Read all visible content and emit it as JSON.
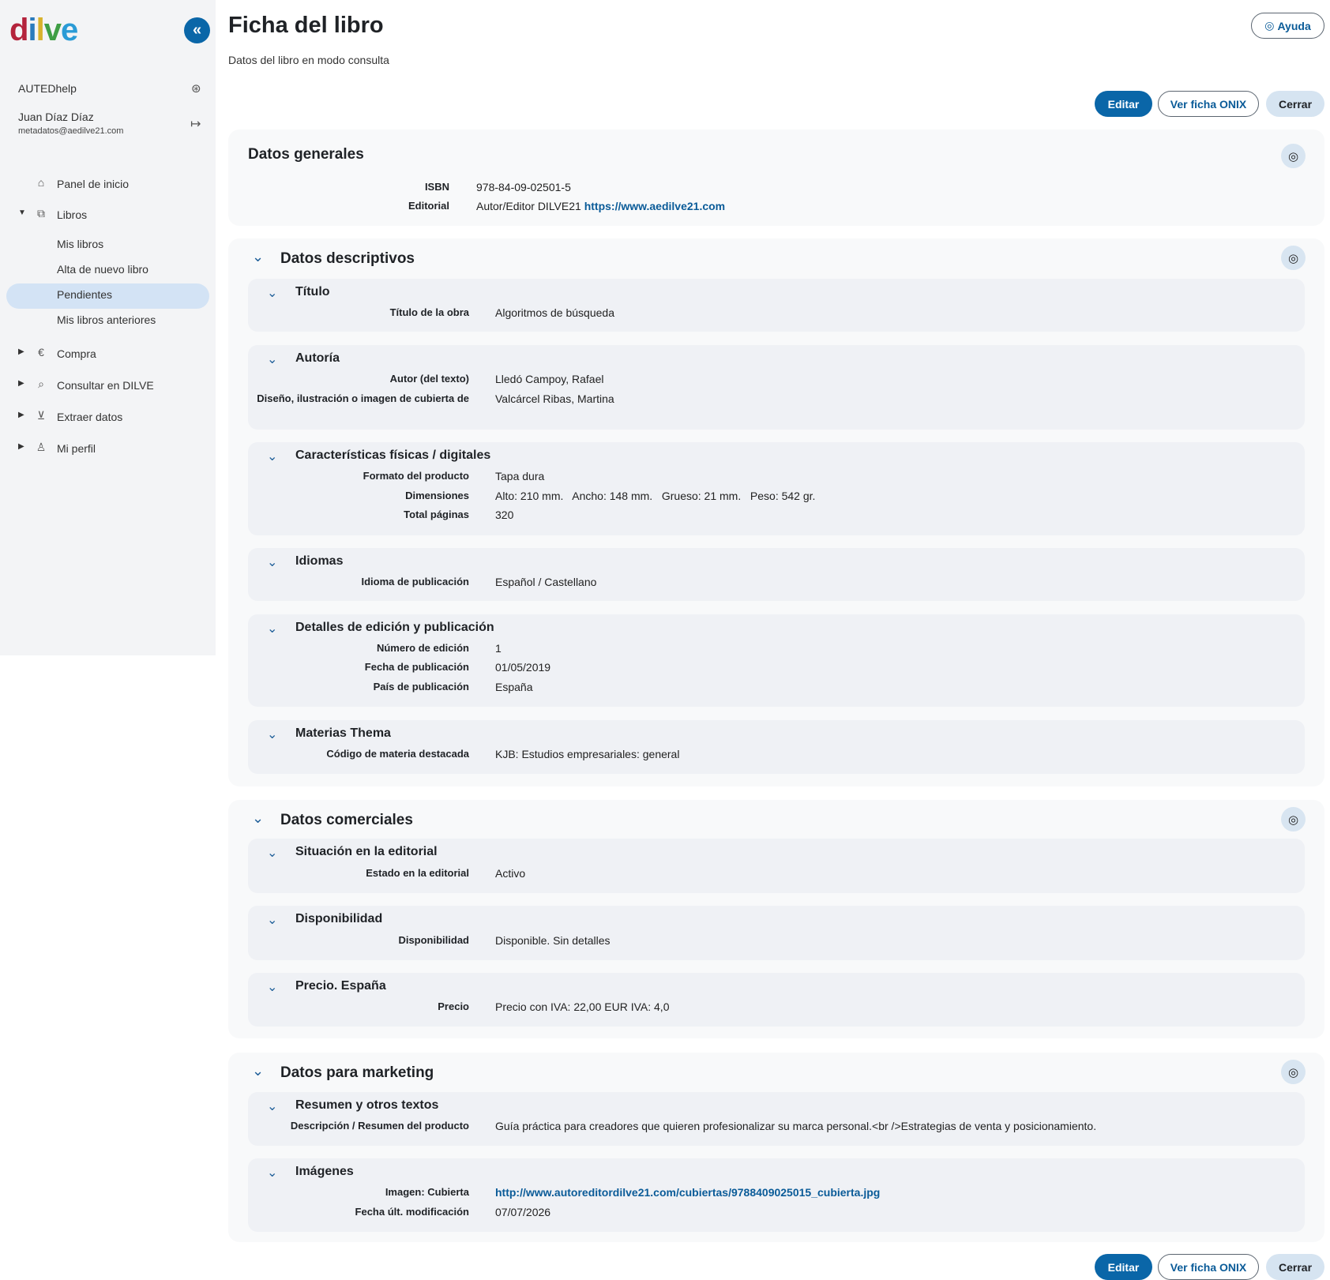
{
  "sidebar": {
    "logo": [
      "d",
      "i",
      "l",
      "v",
      "e"
    ],
    "organization": "AUTEDhelp",
    "user_name": "Juan Díaz Díaz",
    "user_email": "metadatos@aedilve21.com",
    "nav": {
      "home": "Panel de inicio",
      "books": "Libros",
      "my_books": "Mis libros",
      "new_book": "Alta de nuevo libro",
      "pending": "Pendientes",
      "previous_books": "Mis libros anteriores",
      "purchase": "Compra",
      "consult": "Consultar en DILVE",
      "extract": "Extraer datos",
      "profile": "Mi perfil"
    }
  },
  "header": {
    "title": "Ficha del libro",
    "subtitle": "Datos del libro en modo consulta",
    "help_label": "Ayuda"
  },
  "actions": {
    "edit": "Editar",
    "view_onix": "Ver ficha ONIX",
    "close": "Cerrar"
  },
  "general": {
    "title": "Datos generales",
    "isbn_label": "ISBN",
    "isbn": "978-84-09-02501-5",
    "publisher_label": "Editorial",
    "publisher": "Autor/Editor DILVE21",
    "publisher_url": "https://www.aedilve21.com"
  },
  "descriptive": {
    "title": "Datos descriptivos",
    "titulo": {
      "heading": "Título",
      "work_title_label": "Título de la obra",
      "work_title": "Algoritmos de búsqueda"
    },
    "autoria": {
      "heading": "Autoría",
      "author_label": "Autor (del texto)",
      "author": "Lledó Campoy, Rafael",
      "cover_label": "Diseño, ilustración o imagen de cubierta de",
      "cover": "Valcárcel Ribas, Martina"
    },
    "caracteristicas": {
      "heading": "Características físicas / digitales",
      "format_label": "Formato del producto",
      "format": "Tapa dura",
      "dimensions_label": "Dimensiones",
      "dimensions": "Alto: 210 mm.   Ancho: 148 mm.   Grueso: 21 mm.   Peso: 542 gr.",
      "pages_label": "Total páginas",
      "pages": "320"
    },
    "idiomas": {
      "heading": "Idiomas",
      "language_label": "Idioma de publicación",
      "language": "Español / Castellano"
    },
    "edicion": {
      "heading": "Detalles de edición y publicación",
      "edition_label": "Número de edición",
      "edition": "1",
      "date_label": "Fecha de publicación",
      "date": "01/05/2019",
      "country_label": "País de publicación",
      "country": "España"
    },
    "materias": {
      "heading": "Materias Thema",
      "code_label": "Código de materia destacada",
      "code": "KJB: Estudios empresariales: general"
    }
  },
  "commercial": {
    "title": "Datos comerciales",
    "situacion": {
      "heading": "Situación en la editorial",
      "status_label": "Estado en la editorial",
      "status": "Activo"
    },
    "disponibilidad": {
      "heading": "Disponibilidad",
      "availability_label": "Disponibilidad",
      "availability": "Disponible. Sin detalles"
    },
    "precio": {
      "heading": "Precio. España",
      "price_label": "Precio",
      "price": "Precio con IVA: 22,00 EUR IVA: 4,0"
    }
  },
  "marketing": {
    "title": "Datos para marketing",
    "resumen": {
      "heading": "Resumen y otros textos",
      "description_label": "Descripción / Resumen del producto",
      "description": "Guía práctica para creadores que quieren profesionalizar su marca personal.<br />Estrategias de venta y posicionamiento."
    },
    "imagenes": {
      "heading": "Imágenes",
      "cover_label": "Imagen: Cubierta",
      "cover_url": "http://www.autoreditordilve21.com/cubiertas/9788409025015_cubierta.jpg",
      "modified_label": "Fecha últ. modificación",
      "modified": "07/07/2026"
    }
  }
}
